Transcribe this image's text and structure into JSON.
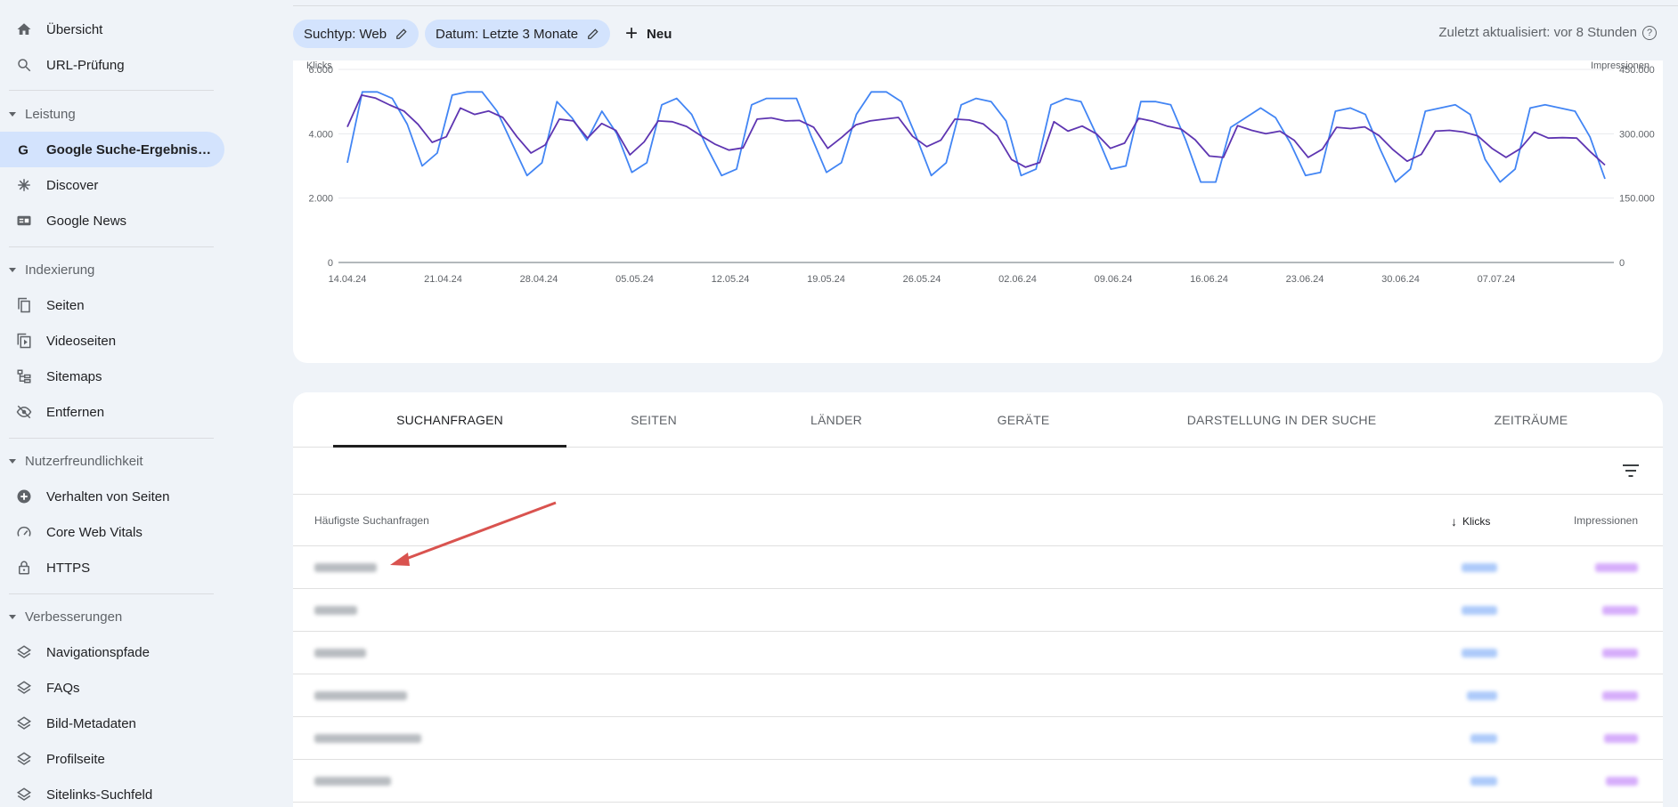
{
  "sidebar": {
    "items_top": [
      {
        "label": "Übersicht",
        "icon": "home-icon"
      },
      {
        "label": "URL-Prüfung",
        "icon": "search-icon"
      }
    ],
    "sections": [
      {
        "title": "Leistung",
        "items": [
          {
            "label": "Google Suche-Ergebnis…",
            "icon": "google-g-icon",
            "active": true
          },
          {
            "label": "Discover",
            "icon": "asterisk-icon"
          },
          {
            "label": "Google News",
            "icon": "news-icon"
          }
        ]
      },
      {
        "title": "Indexierung",
        "items": [
          {
            "label": "Seiten",
            "icon": "pages-icon"
          },
          {
            "label": "Videoseiten",
            "icon": "video-pages-icon"
          },
          {
            "label": "Sitemaps",
            "icon": "sitemap-icon"
          },
          {
            "label": "Entfernen",
            "icon": "eye-off-icon"
          }
        ]
      },
      {
        "title": "Nutzerfreundlichkeit",
        "items": [
          {
            "label": "Verhalten von Seiten",
            "icon": "plus-circle-icon"
          },
          {
            "label": "Core Web Vitals",
            "icon": "gauge-icon"
          },
          {
            "label": "HTTPS",
            "icon": "lock-icon"
          }
        ]
      },
      {
        "title": "Verbesserungen",
        "items": [
          {
            "label": "Navigationspfade",
            "icon": "layers-icon"
          },
          {
            "label": "FAQs",
            "icon": "layers-icon"
          },
          {
            "label": "Bild-Metadaten",
            "icon": "layers-icon"
          },
          {
            "label": "Profilseite",
            "icon": "layers-icon"
          },
          {
            "label": "Sitelinks-Suchfeld",
            "icon": "layers-icon"
          }
        ]
      }
    ]
  },
  "filters": {
    "search_type": "Suchtyp: Web",
    "date": "Datum: Letzte 3 Monate",
    "new_label": "Neu",
    "updated": "Zuletzt aktualisiert: vor 8 Stunden"
  },
  "chart_data": {
    "type": "line",
    "left_axis_label": "Klicks",
    "right_axis_label": "Impressionen",
    "left_ticks": [
      "0",
      "2.000",
      "4.000",
      "6.000"
    ],
    "right_ticks": [
      "0",
      "150.000",
      "300.000",
      "450.000"
    ],
    "ylim_left": [
      0,
      6000
    ],
    "ylim_right": [
      0,
      450000
    ],
    "x_tick_labels": [
      "14.04.24",
      "21.04.24",
      "28.04.24",
      "05.05.24",
      "12.05.24",
      "19.05.24",
      "26.05.24",
      "02.06.24",
      "09.06.24",
      "16.06.24",
      "23.06.24",
      "30.06.24",
      "07.07.24"
    ],
    "series": [
      {
        "name": "Klicks",
        "axis": "left",
        "color": "#4285f4",
        "values": [
          3100,
          5300,
          5300,
          5100,
          4300,
          3000,
          3400,
          5200,
          5300,
          5300,
          4700,
          3700,
          2700,
          3100,
          5000,
          4500,
          3800,
          4700,
          4000,
          2800,
          3100,
          4900,
          5100,
          4600,
          3600,
          2700,
          2900,
          4900,
          5100,
          5100,
          5100,
          3900,
          2800,
          3100,
          4600,
          5300,
          5300,
          5000,
          3900,
          2700,
          3100,
          4900,
          5100,
          5000,
          4400,
          2700,
          2900,
          4900,
          5100,
          5000,
          4000,
          2900,
          3000,
          5000,
          5000,
          4900,
          3800,
          2500,
          2500,
          4200,
          4500,
          4800,
          4500,
          3700,
          2700,
          2800,
          4700,
          4800,
          4600,
          3500,
          2500,
          2900,
          4700,
          4800,
          4900,
          4600,
          3200,
          2500,
          2900,
          4800,
          4900,
          4800,
          4700,
          3900,
          2600
        ]
      },
      {
        "name": "Impressionen",
        "axis": "right",
        "color": "#5e35b1",
        "values": [
          316000,
          390000,
          383000,
          367000,
          353000,
          322000,
          280000,
          293000,
          360000,
          345000,
          353000,
          338000,
          293000,
          255000,
          274000,
          334000,
          330000,
          290000,
          324000,
          308000,
          251000,
          281000,
          330000,
          328000,
          317000,
          296000,
          276000,
          262000,
          267000,
          334000,
          337000,
          330000,
          331000,
          315000,
          266000,
          292000,
          321000,
          330000,
          334000,
          338000,
          294000,
          270000,
          285000,
          334000,
          332000,
          323000,
          295000,
          240000,
          222000,
          233000,
          328000,
          306000,
          318000,
          300000,
          266000,
          278000,
          336000,
          329000,
          318000,
          311000,
          286000,
          248000,
          245000,
          319000,
          308000,
          300000,
          306000,
          285000,
          245000,
          264000,
          315000,
          312000,
          316000,
          296000,
          263000,
          236000,
          252000,
          306000,
          308000,
          304000,
          295000,
          266000,
          245000,
          265000,
          304000,
          290000,
          291000,
          290000,
          257000,
          227000
        ]
      }
    ]
  },
  "table": {
    "tabs": [
      "SUCHANFRAGEN",
      "SEITEN",
      "LÄNDER",
      "GERÄTE",
      "DARSTELLUNG IN DER SUCHE",
      "ZEITRÄUME"
    ],
    "columns": {
      "query": "Häufigste Suchanfragen",
      "clicks": "Klicks",
      "impressions": "Impressionen"
    },
    "rows": [
      {
        "q_w": 70,
        "c_w": 40,
        "i_w": 48
      },
      {
        "q_w": 48,
        "c_w": 40,
        "i_w": 40
      },
      {
        "q_w": 58,
        "c_w": 40,
        "i_w": 40
      },
      {
        "q_w": 104,
        "c_w": 34,
        "i_w": 40
      },
      {
        "q_w": 120,
        "c_w": 30,
        "i_w": 38
      },
      {
        "q_w": 86,
        "c_w": 30,
        "i_w": 36
      }
    ]
  }
}
